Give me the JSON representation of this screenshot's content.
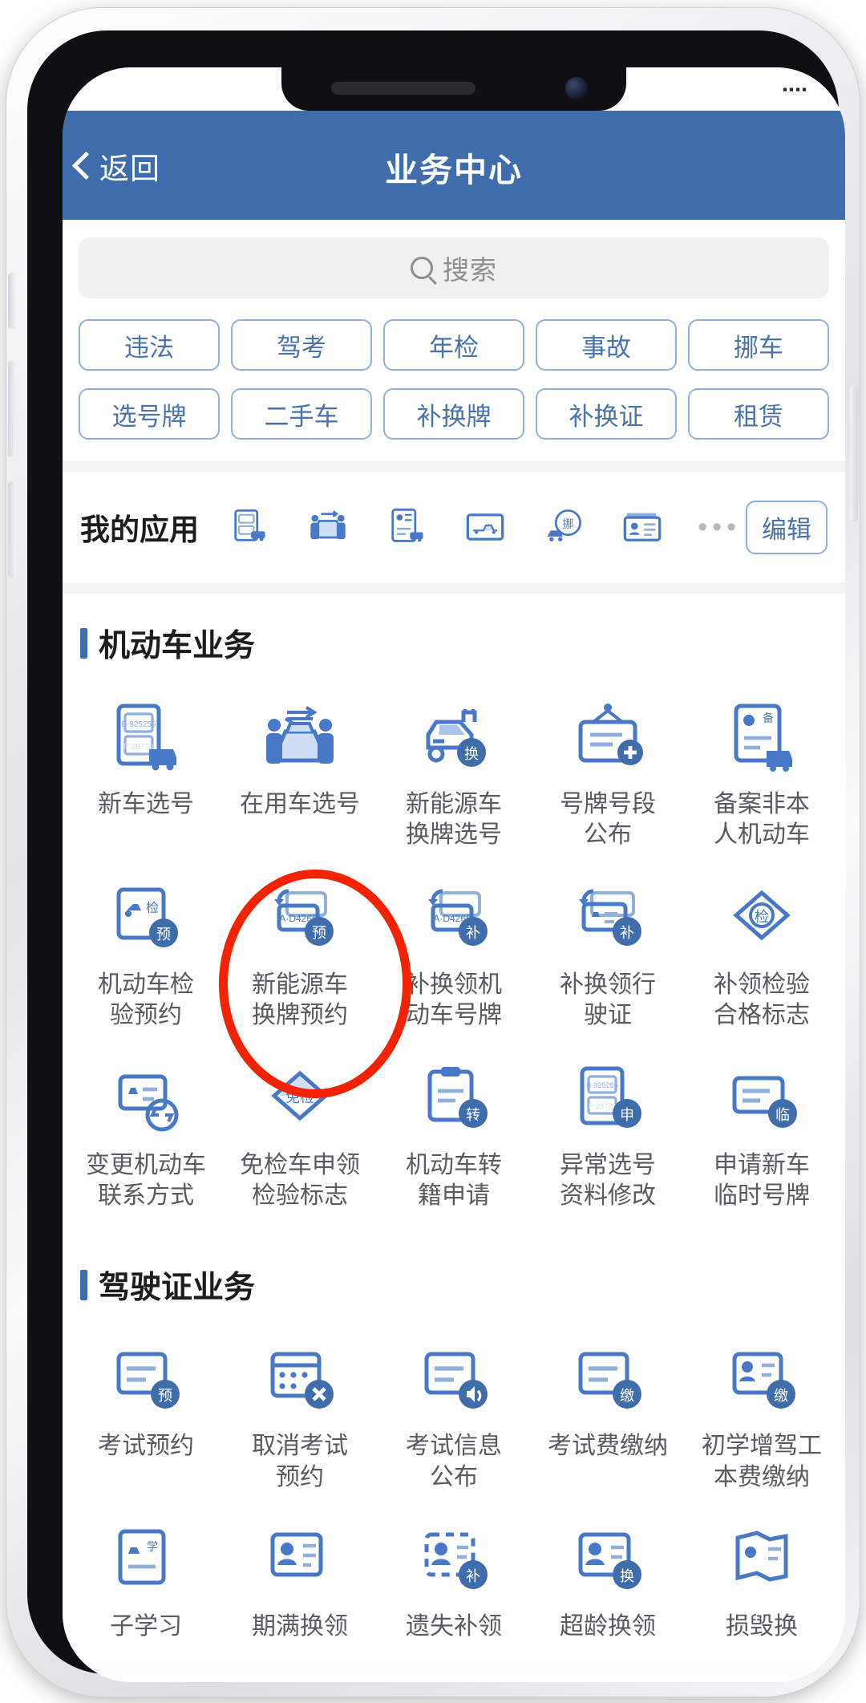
{
  "header": {
    "back_label": "返回",
    "title": "业务中心",
    "bar_color": "#3f6cab"
  },
  "status_bar": {
    "signal": "▪▪▪▪"
  },
  "search": {
    "placeholder": "搜索",
    "value": "",
    "icon": "search-icon"
  },
  "tags": [
    "违法",
    "驾考",
    "年检",
    "事故",
    "挪车",
    "选号牌",
    "二手车",
    "补换牌",
    "补换证",
    "租赁"
  ],
  "my_apps": {
    "title": "我的应用",
    "edit_label": "编辑",
    "more_dots": "•••",
    "icons": [
      "plate-select-icon",
      "vehicle-inspection-people-icon",
      "document-vehicle-icon",
      "accident-photo-icon",
      "move-car-icon",
      "driver-license-card-icon"
    ]
  },
  "sections": [
    {
      "title": "机动车业务",
      "items": [
        {
          "icon": "new-car-plate-icon",
          "label": "新车选号"
        },
        {
          "icon": "in-use-car-plate-icon",
          "label": "在用车选号"
        },
        {
          "icon": "new-energy-change-plate-icon",
          "label": "新能源车\n换牌选号"
        },
        {
          "icon": "plate-number-publish-icon",
          "label": "号牌号段\n公布"
        },
        {
          "icon": "record-non-self-vehicle-icon",
          "label": "备案非本\n人机动车"
        },
        {
          "icon": "vehicle-inspection-appt-icon",
          "label": "机动车检\n验预约"
        },
        {
          "icon": "new-energy-plate-appt-icon",
          "label": "新能源车\n换牌预约"
        },
        {
          "icon": "replace-plate-icon",
          "label": "补换领机\n动车号牌"
        },
        {
          "icon": "replace-license-icon",
          "label": "补换领行\n驶证"
        },
        {
          "icon": "inspection-mark-icon",
          "label": "补领检验\n合格标志"
        },
        {
          "icon": "change-contact-icon",
          "label": "变更机动车\n联系方式"
        },
        {
          "icon": "exempt-inspection-mark-icon",
          "label": "免检车申领\n检验标志"
        },
        {
          "icon": "vehicle-transfer-icon",
          "label": "机动车转\n籍申请"
        },
        {
          "icon": "abnormal-plate-edit-icon",
          "label": "异常选号\n资料修改"
        },
        {
          "icon": "temp-plate-icon",
          "label": "申请新车\n临时号牌"
        }
      ]
    },
    {
      "title": "驾驶证业务",
      "items": [
        {
          "icon": "exam-appointment-icon",
          "label": "考试预约"
        },
        {
          "icon": "cancel-exam-appt-icon",
          "label": "取消考试\n预约"
        },
        {
          "icon": "exam-info-publish-icon",
          "label": "考试信息\n公布"
        },
        {
          "icon": "exam-fee-pay-icon",
          "label": "考试费缴纳"
        },
        {
          "icon": "learner-fee-pay-icon",
          "label": "初学增驾工\n本费缴纳"
        },
        {
          "icon": "electronic-study-icon",
          "label": "子学习"
        },
        {
          "icon": "expiry-renewal-icon",
          "label": "期满换领"
        },
        {
          "icon": "lost-reissue-icon",
          "label": "遗失补领"
        },
        {
          "icon": "over-age-renewal-icon",
          "label": "超龄换领"
        },
        {
          "icon": "damaged-renewal-icon",
          "label": "损毁换"
        }
      ]
    }
  ],
  "annotation": {
    "shape": "red-ellipse",
    "target_label": "免检车申领检验标志",
    "color": "#f52200"
  },
  "colors": {
    "brand_blue": "#3f6cab",
    "icon_blue": "#4878c8",
    "tag_border": "#8fb0dd",
    "tag_text": "#4a73ac",
    "label_gray": "#5a5a5f",
    "page_bg": "#f2f3f5",
    "annotation_red": "#f52200"
  }
}
